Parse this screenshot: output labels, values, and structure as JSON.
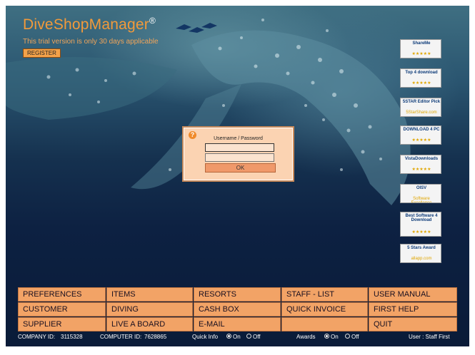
{
  "brand": {
    "logo_part1": "Dive",
    "logo_part2": "Shop",
    "logo_part3": "Manager",
    "logo_mark": "®"
  },
  "trial_text": "This trial version is only 30 days applicable",
  "register_label": "REGISTER",
  "login": {
    "title": "Username / Password",
    "username_value": "",
    "password_value": "",
    "ok_label": "OK",
    "help_glyph": "?"
  },
  "awards": [
    {
      "title": "ShareMe",
      "stars": "★★★★★"
    },
    {
      "title": "Top 4 download",
      "stars": "★★★★★"
    },
    {
      "title": "5STAR Editor Pick",
      "stars": "5StarShare.com"
    },
    {
      "title": "DOWNLOAD 4 PC",
      "stars": "★★★★★"
    },
    {
      "title": "VistaDownloads",
      "stars": "★★★★★"
    },
    {
      "title": "OISV",
      "stars": "Software Excellence"
    },
    {
      "title": "Best Software 4 Download",
      "stars": "★★★★★"
    },
    {
      "title": "5 Stars Award",
      "stars": "allapp.com"
    }
  ],
  "menu": {
    "rows": [
      [
        "PREFERENCES",
        "ITEMS",
        "RESORTS",
        "STAFF - LIST",
        "USER MANUAL"
      ],
      [
        "CUSTOMER",
        "DIVING",
        "CASH BOX",
        "QUICK INVOICE",
        "FIRST HELP"
      ],
      [
        "SUPPLIER",
        "LIVE A BOARD",
        "E-MAIL",
        "",
        "QUIT"
      ]
    ]
  },
  "status": {
    "company_label": "COMPANY ID:",
    "company_id": "3115328",
    "computer_label": "COMPUTER ID:",
    "computer_id": "7628865",
    "quick_info_label": "Quick Info",
    "on_label": "On",
    "off_label": "Off",
    "awards_label": "Awards",
    "user_label": "User : Staff First"
  },
  "colors": {
    "accent": "#f2a366",
    "logo_orange": "#f29a3a",
    "background": "#0d2142"
  }
}
